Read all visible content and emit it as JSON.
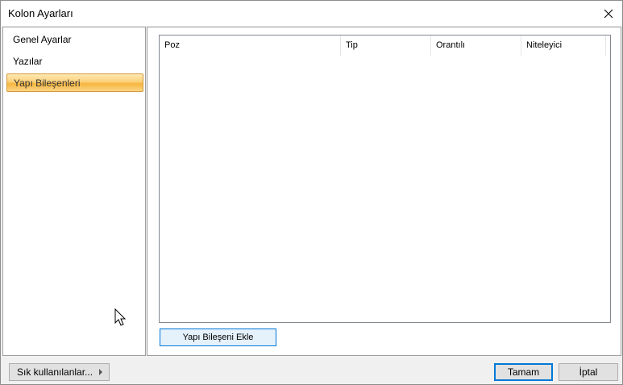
{
  "window": {
    "title": "Kolon Ayarları"
  },
  "sidebar": {
    "items": [
      {
        "label": "Genel Ayarlar",
        "selected": false
      },
      {
        "label": "Yazılar",
        "selected": false
      },
      {
        "label": "Yapı Bileşenleri",
        "selected": true
      }
    ]
  },
  "list": {
    "columns": [
      "Poz",
      "Tip",
      "Orantılı",
      "Niteleyici"
    ],
    "rows": []
  },
  "buttons": {
    "add_component": "Yapı Bileşeni Ekle",
    "favorites": "Sık kullanılanlar...",
    "ok": "Tamam",
    "cancel": "İptal"
  },
  "colors": {
    "selected_item": "#f7b53e",
    "focus_border": "#0078d7"
  },
  "icons": {
    "close": "close-icon",
    "submenu": "chevron-right-icon",
    "cursor": "mouse-pointer-icon"
  }
}
